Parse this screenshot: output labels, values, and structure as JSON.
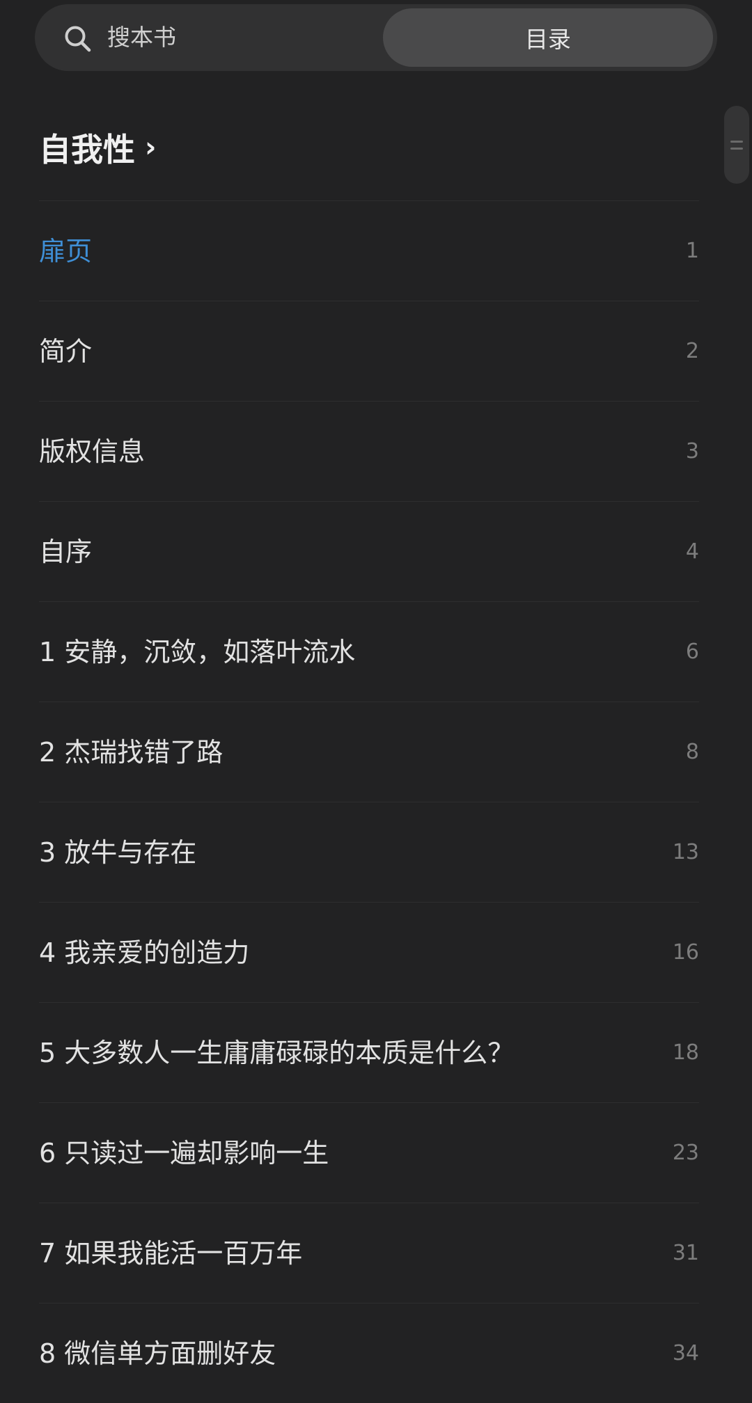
{
  "header": {
    "search_label": "搜本书",
    "toc_tab_label": "目录"
  },
  "book": {
    "title": "自我性",
    "chevron": "›"
  },
  "toc": [
    {
      "label": "扉页",
      "page": "1",
      "active": true
    },
    {
      "label": "简介",
      "page": "2",
      "active": false
    },
    {
      "label": "版权信息",
      "page": "3",
      "active": false
    },
    {
      "label": "自序",
      "page": "4",
      "active": false
    },
    {
      "label": "1 安静，沉敛，如落叶流水",
      "page": "6",
      "active": false
    },
    {
      "label": "2 杰瑞找错了路",
      "page": "8",
      "active": false
    },
    {
      "label": "3 放牛与存在",
      "page": "13",
      "active": false
    },
    {
      "label": "4 我亲爱的创造力",
      "page": "16",
      "active": false
    },
    {
      "label": "5 大多数人一生庸庸碌碌的本质是什么？",
      "page": "18",
      "active": false
    },
    {
      "label": "6 只读过一遍却影响一生",
      "page": "23",
      "active": false
    },
    {
      "label": "7 如果我能活一百万年",
      "page": "31",
      "active": false
    },
    {
      "label": "8 微信单方面删好友",
      "page": "34",
      "active": false
    }
  ],
  "colors": {
    "background": "#222223",
    "active_item": "#3f8fd6",
    "page_number": "#7d7d7d"
  },
  "icons": {
    "search": "search-icon",
    "title_chevron": "chevron-right-icon",
    "scroll_handle": "scroll-handle-icon"
  }
}
